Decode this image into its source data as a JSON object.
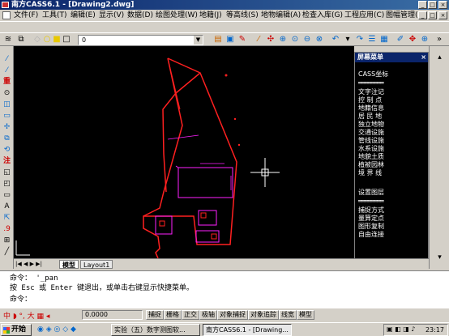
{
  "title_bar": {
    "title": "南方CASS6.1 - [Drawing2.dwg]"
  },
  "menu": [
    "文件(F)",
    "工具(T)",
    "编辑(E)",
    "显示(V)",
    "数据(D)",
    "绘图处理(W)",
    "地籍(J)",
    "等高线(S)",
    "地物编辑(A)",
    "检查入库(G)",
    "工程应用(C)",
    "图幅管理(M)"
  ],
  "layer_combo": {
    "value": "0"
  },
  "screen_menu": {
    "title": "屏幕菜单",
    "items": [
      "CASS坐标",
      "文字注记",
      "控 制 点",
      "地籍信息",
      "居 民 地",
      "独立地物",
      "交通设施",
      "管线设施",
      "水系设施",
      "境界线",
      "地貌土质",
      "植被园林",
      "境 界 线",
      "设置图层",
      "捕捉方式",
      "量算定点",
      "图形复制",
      "自由连接"
    ]
  },
  "tabs": {
    "model": "模型",
    "layout": "Layout1"
  },
  "command": {
    "line1": "命令：  '_pan",
    "line2": "按 Esc 或 Enter 键退出，或单击右键显示快捷菜单。",
    "line3": "命令："
  },
  "status": {
    "coord": "0.0000",
    "buttons": [
      "捕捉",
      "栅格",
      "正交",
      "极轴",
      "对象捕捉",
      "对象追踪",
      "线宽",
      "模型"
    ]
  },
  "taskbar": {
    "start": "开始",
    "tasks": [
      "实验（五）数字测图软...",
      "南方CASS6.1 - [Drawing..."
    ],
    "clock": "23:17"
  },
  "colors": {
    "drawing_red": "#ff2020",
    "drawing_magenta": "#ff20ff",
    "canvas_bg": "#000000",
    "title_blue": "#0a246a"
  }
}
